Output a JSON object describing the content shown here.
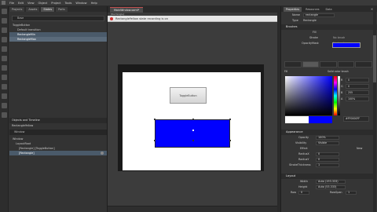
{
  "menu": [
    "File",
    "Edit",
    "View",
    "Object",
    "Project",
    "Tools",
    "Window",
    "Help"
  ],
  "left_tabs": [
    "Projects",
    "Assets",
    "States",
    "Parts"
  ],
  "states": {
    "search": "Base",
    "items": [
      "ToggleButton",
      "Default transition",
      "RectangleMin",
      "RectangleMax"
    ]
  },
  "objects_timeline": {
    "header": "Objects and Timeline",
    "subheader": "RectangleYellow",
    "bar": "Window",
    "items": [
      "Window",
      "LayoutRoot",
      "[Rectangle] [ToggleButton]",
      "[Rectangle]"
    ]
  },
  "document": {
    "tab": "MainWindow.xaml*",
    "tab_sub": "[Rectangle]",
    "error": "RectangleYellow state recording is on",
    "button_label": "ToggleButton"
  },
  "right_tabs": [
    "Properties",
    "Resources",
    "Data"
  ],
  "properties": {
    "name_label": "Name",
    "name_value": "rectangle",
    "type_label": "Type",
    "type_value": "Rectangle",
    "brushes_header": "Brushes",
    "fill_label": "Fill",
    "stroke_label": "Stroke",
    "opacity_mask_label": "OpacityMask",
    "brush_values": [
      "No brush",
      "Solid color brush"
    ],
    "rgb": [
      {
        "letter": "R",
        "value": "0"
      },
      {
        "letter": "G",
        "value": "0"
      },
      {
        "letter": "B",
        "value": "255"
      },
      {
        "letter": "A",
        "value": "100%"
      }
    ],
    "hex": "#FF0000FF",
    "appearance_header": "Appearance",
    "opacity_label": "Opacity",
    "opacity_value": "100%",
    "visibility_label": "Visibility",
    "visibility_value": "Visible",
    "effect_label": "Effect",
    "effect_value": "New",
    "radiusx_label": "RadiusX",
    "radiusx_value": "0",
    "radiusy_label": "RadiusY",
    "radiusy_value": "0",
    "stroke_thickness_label": "StrokeThickness",
    "stroke_thickness_value": "1",
    "layout_header": "Layout",
    "width_label": "Width",
    "width_value": "Auto (193.333)",
    "height_label": "Height",
    "height_value": "Auto (53.333)",
    "row_label": "Row",
    "row_value": "0",
    "rowspan_label": "RowSpan",
    "rowspan_value": "1"
  },
  "colors": {
    "accent_fill": "#0000FF",
    "error": "#D03030"
  }
}
